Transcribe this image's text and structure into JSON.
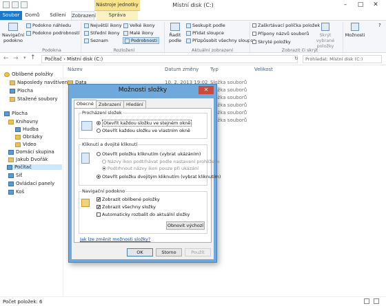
{
  "window": {
    "title": "Místní disk (C:)",
    "context_tab_group": "Nástroje jednotky",
    "min_glyph": "–",
    "max_glyph": "□",
    "close_glyph": "✕"
  },
  "tabs": {
    "file": "Soubor",
    "home": "Domů",
    "share": "Sdílení",
    "view": "Zobrazení",
    "manage": "Správa"
  },
  "ribbon": {
    "nav_pane": "Navigační podokno",
    "preview_pane": "Podokno náhledu",
    "details_pane": "Podokno podrobností",
    "group_panes": "Podokna",
    "layout_items": [
      "Největší ikony",
      "Velké ikony",
      "Střední ikony",
      "Malé ikony",
      "Seznam",
      "Podrobnosti"
    ],
    "group_layout": "Rozložení",
    "sort_by": "Řadit podle",
    "group_by": "Seskupit podle",
    "add_columns": "Přidat sloupce",
    "fit_columns": "Přizpůsobit všechny sloupce",
    "group_current_view": "Aktuální zobrazení",
    "item_checkboxes": "Zaškrtávací políčka položek",
    "file_extensions": "Přípony názvů souborů",
    "hidden_items": "Skryté položky",
    "hide_selected": "Skrýt vybrané položky",
    "group_show_hide": "Zobrazit či skrýt",
    "options": "Možnosti"
  },
  "address": {
    "path": "Počítač  ›  Místní disk (C:)",
    "search_placeholder": "Prohledat: Místní disk (C:)"
  },
  "nav": {
    "favorites": "Oblíbené položky",
    "recent": "Naposledy navštíven",
    "desktop": "Plocha",
    "downloads": "Stažené soubory",
    "desktop2": "Plocha",
    "libraries": "Knihovny",
    "music": "Hudba",
    "pictures": "Obrázky",
    "videos": "Video",
    "homegroup": "Domácí skupina",
    "user": "Jakub Dvořák",
    "computer": "Počítač",
    "network": "Síť",
    "control_panel": "Ovládací panely",
    "recycle": "Koš"
  },
  "columns": {
    "name": "Název",
    "date": "Datum změny",
    "type": "Typ",
    "size": "Velikost"
  },
  "files": [
    {
      "name": "Data",
      "date": "10. 2. 2013 19:02",
      "type": "Složka souborů"
    },
    {
      "name": "",
      "date": "",
      "type": "Složka souborů"
    },
    {
      "name": "",
      "date": "",
      "type": "Složka souborů"
    },
    {
      "name": "",
      "date": "",
      "type": "Složka souborů"
    },
    {
      "name": "",
      "date": "",
      "type": "Složka souborů"
    },
    {
      "name": "",
      "date": "",
      "type": "Složka souborů"
    }
  ],
  "status": {
    "count": "Počet položek: 6"
  },
  "dialog": {
    "title": "Možnosti složky",
    "close": "✕",
    "tabs": [
      "Obecné",
      "Zobrazení",
      "Hledání"
    ],
    "browse_group": "Procházení složek",
    "browse_same": "Otevřít každou složku ve stejném okně",
    "browse_new": "Otevřít každou složku ve vlastním okně",
    "click_group": "Kliknutí a dvojité kliknutí",
    "single_click": "Otevřít položku kliknutím (vybrat ukázáním)",
    "underline_browser": "Názvy ikon podtrhávat podle nastavení prohlížeče",
    "underline_hover": "Podtrhnout názvy ikon pouze při ukázání",
    "double_click": "Otevřít položku dvojitým kliknutím (vybrat kliknutím)",
    "nav_group": "Navigační podokno",
    "show_favorites": "Zobrazit oblíbené položky",
    "show_all": "Zobrazit všechny složky",
    "auto_expand": "Automaticky rozbalit do aktuální složky",
    "restore": "Obnovit výchozí",
    "help_link": "Jak lze změnit možnosti složky?",
    "ok": "OK",
    "cancel": "Storno",
    "apply": "Použít",
    "checkmark": "✔"
  }
}
